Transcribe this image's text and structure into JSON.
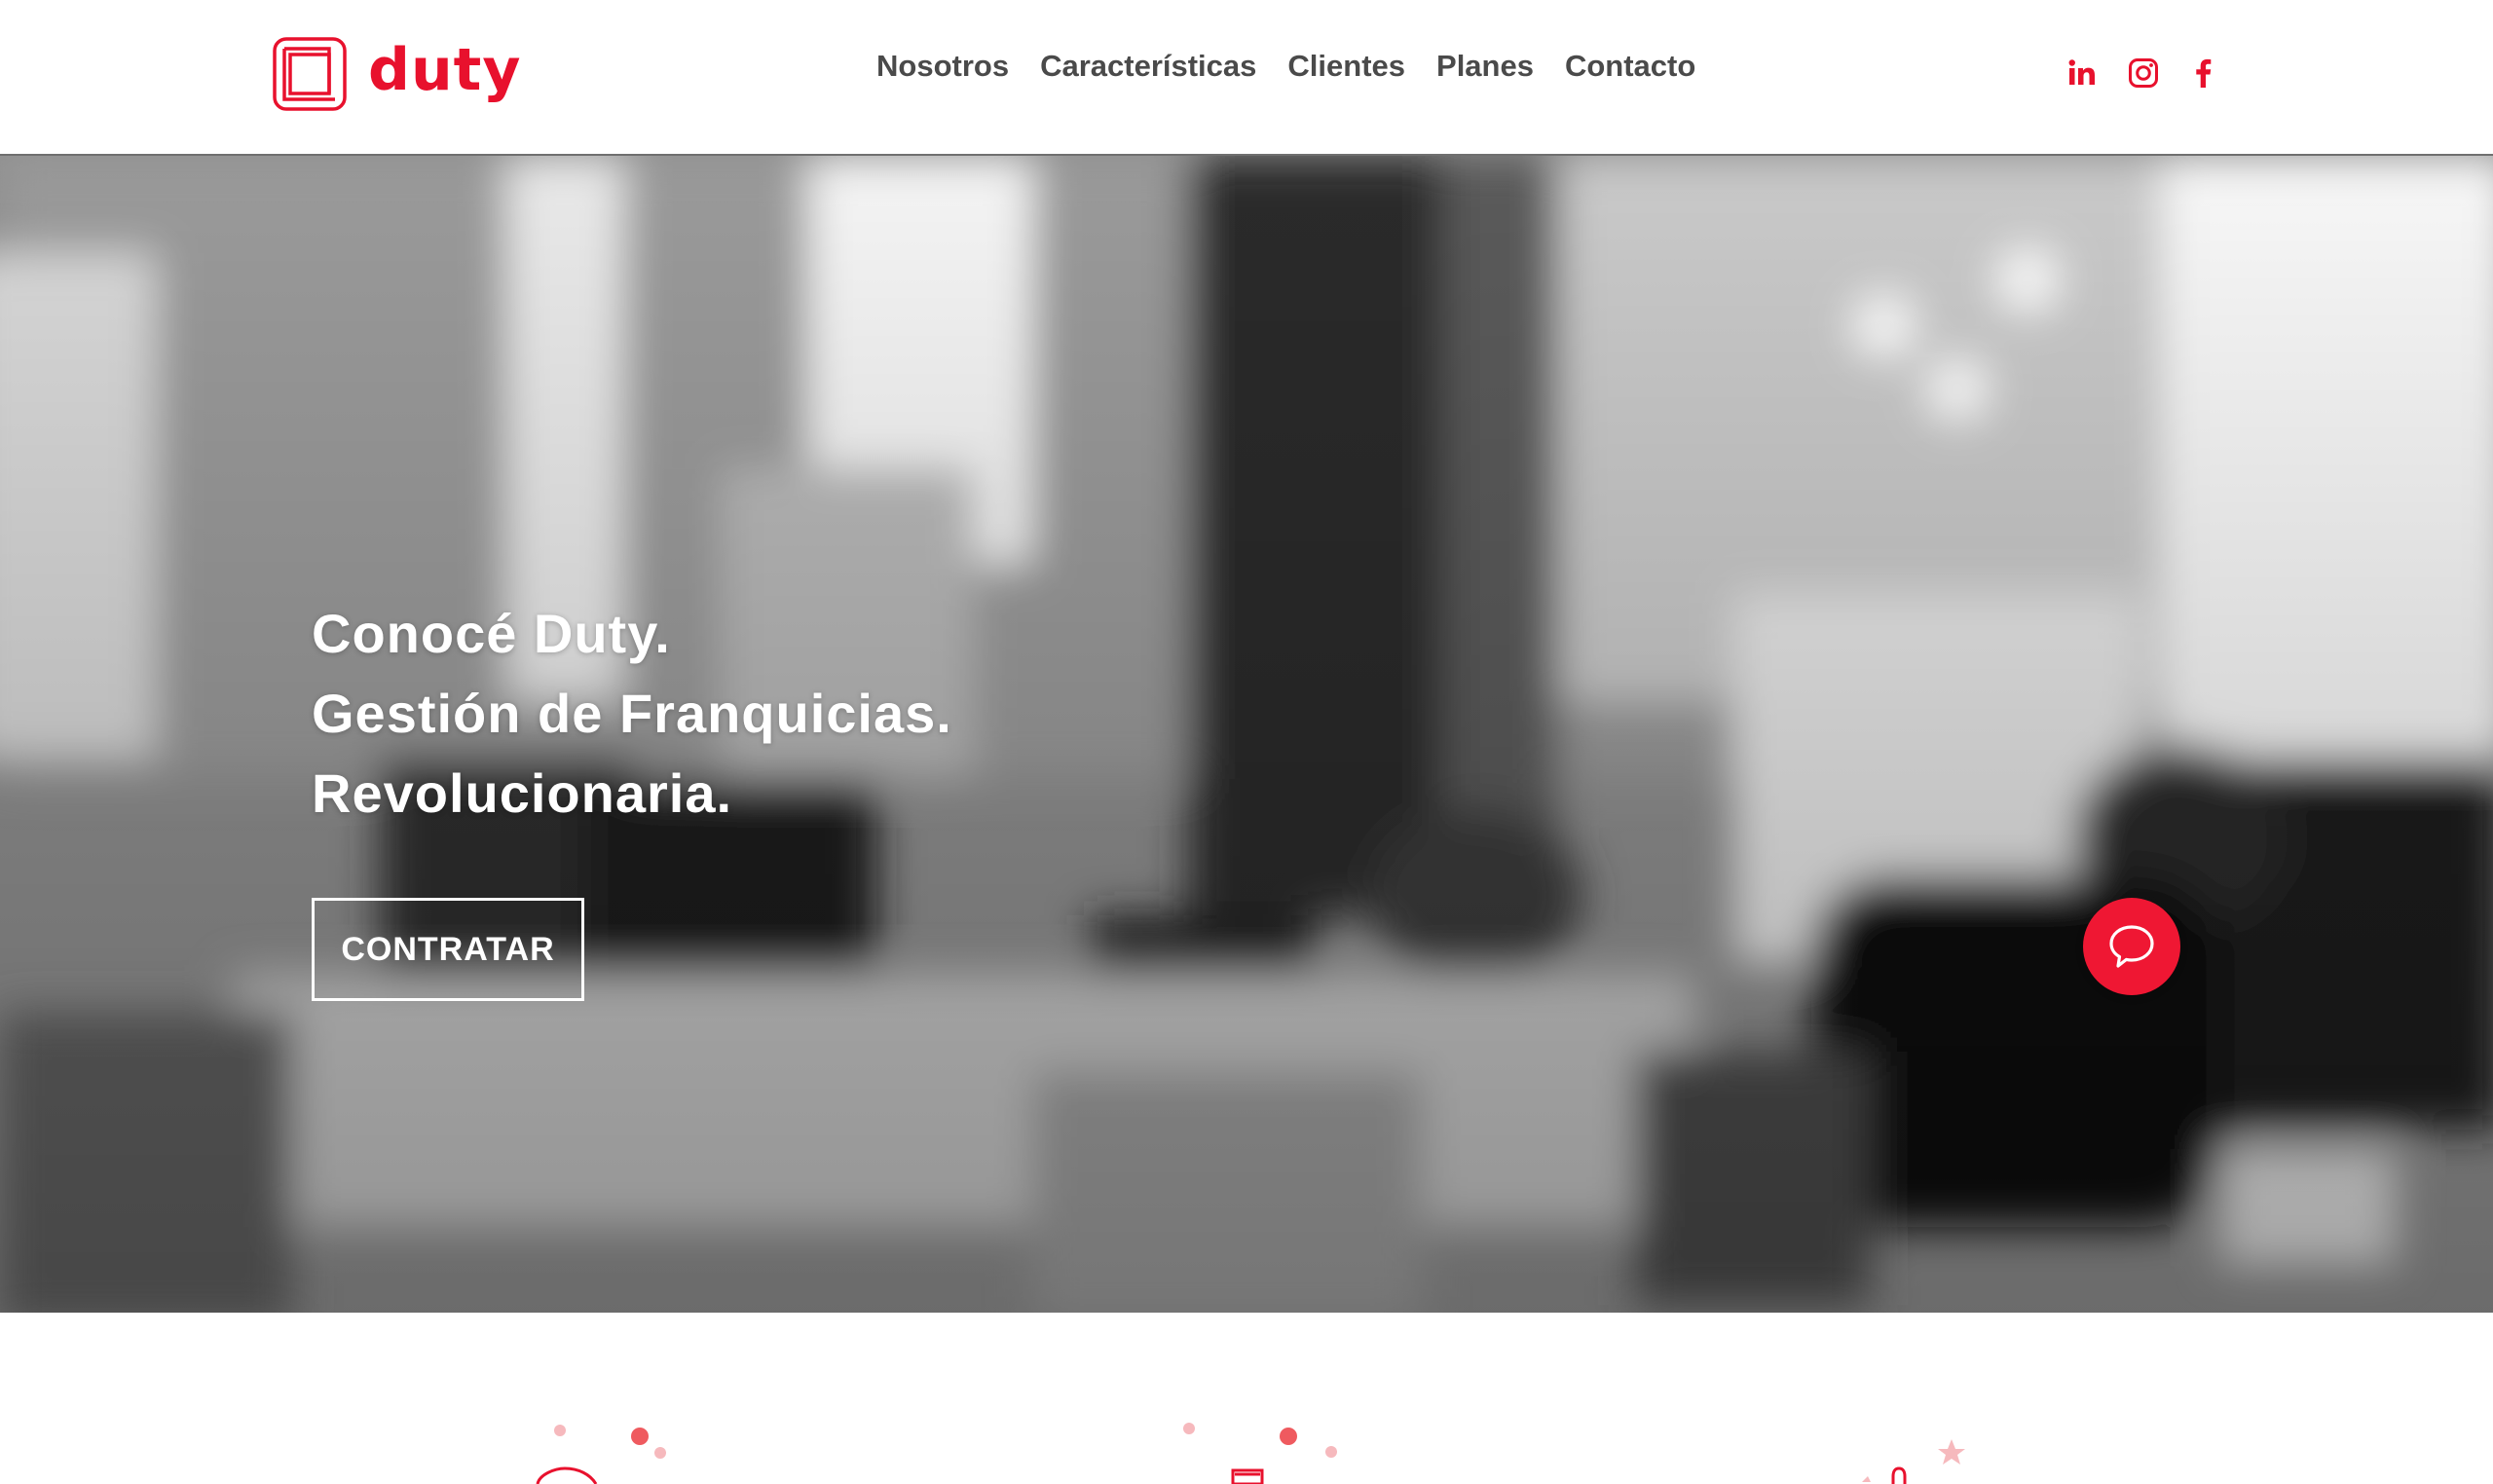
{
  "brand": {
    "name": "duty",
    "accent_color": "#e8112d"
  },
  "nav": {
    "items": [
      {
        "label": "Nosotros"
      },
      {
        "label": "Características"
      },
      {
        "label": "Clientes"
      },
      {
        "label": "Planes"
      },
      {
        "label": "Contacto"
      }
    ]
  },
  "social": [
    {
      "icon": "linkedin-icon"
    },
    {
      "icon": "instagram-icon"
    },
    {
      "icon": "facebook-icon"
    }
  ],
  "hero": {
    "lines": [
      "Conocé Duty.",
      "Gestión de Franquicias.",
      "Revolucionaria."
    ],
    "cta_label": "CONTRATAR",
    "chat_icon": "chat-bubble-icon"
  },
  "features": {
    "icons": [
      "feature-icon-1",
      "feature-icon-2",
      "feature-icon-3"
    ]
  }
}
